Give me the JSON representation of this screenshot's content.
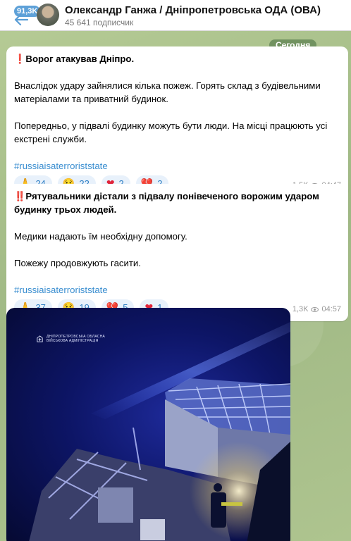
{
  "header": {
    "unread_badge": "91,3K",
    "channel_title": "Олександр Ганжа / Дніпропетровська ОДА (ОВА)",
    "subscribers": "45 641 подписчик"
  },
  "date_separator": "Сегодня",
  "messages": [
    {
      "headline_emoji": "❗",
      "headline": "Ворог атакував Дніпро.",
      "paragraphs": [
        "Внаслідок удару зайнялися кілька пожеж. Горять склад з будівельними матеріалами та приватний будинок.",
        "Попередньо, у підвалі будинку можуть бути  люди. На місці працюють усі екстрені служби."
      ],
      "hashtag": "#russiaisaterroriststate",
      "reactions": [
        {
          "emoji": "🙏",
          "count": "24"
        },
        {
          "emoji": "😢",
          "count": "22"
        },
        {
          "emoji": "❤",
          "count": "2"
        },
        {
          "emoji": "💔",
          "count": "2"
        }
      ],
      "views": "1,5K",
      "time": "04:47"
    },
    {
      "headline_emoji": "‼️",
      "headline": "Рятувальники дістали  з підвалу понівеченого ворожим ударом будинку трьох людей.",
      "paragraphs": [
        "Медики надають їм необхідну допомогу.",
        "Пожежу продовжують гасити."
      ],
      "hashtag": "#russiaisaterroriststate",
      "reactions": [
        {
          "emoji": "🙏",
          "count": "37"
        },
        {
          "emoji": "😢",
          "count": "19"
        },
        {
          "emoji": "💔",
          "count": "5"
        },
        {
          "emoji": "❤",
          "count": "1"
        }
      ],
      "views": "1,3K",
      "time": "04:57"
    }
  ],
  "photo": {
    "watermark_line1": "ДНІПРОПЕТРОВСЬКА ОБЛАСНА",
    "watermark_line2": "ВІЙСЬКОВА АДМІНІСТРАЦІЯ"
  }
}
